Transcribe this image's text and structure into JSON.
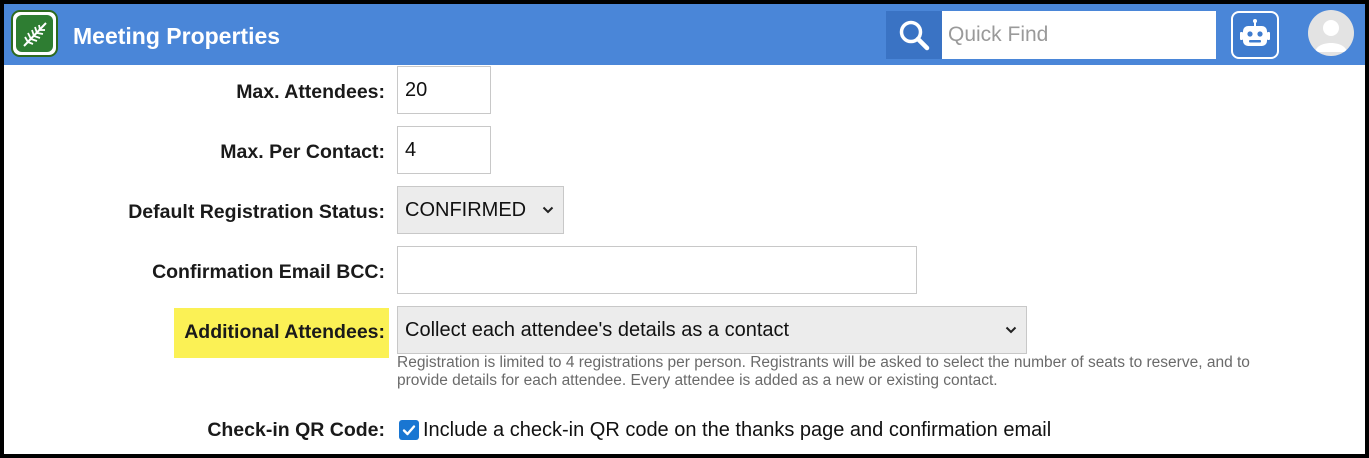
{
  "header": {
    "title": "Meeting Properties",
    "search_placeholder": "Quick Find",
    "icons": [
      "leaf-logo-icon",
      "search-icon",
      "robot-icon",
      "user-avatar-icon"
    ],
    "colors": {
      "bar": "#4a86d8",
      "search_button": "#3a73c4"
    }
  },
  "form": {
    "max_attendees": {
      "label": "Max. Attendees:",
      "value": "20"
    },
    "max_per_contact": {
      "label": "Max. Per Contact:",
      "value": "4"
    },
    "default_status": {
      "label": "Default Registration Status:",
      "value": "CONFIRMED"
    },
    "confirmation_bcc": {
      "label": "Confirmation Email BCC:",
      "value": ""
    },
    "additional_attendees": {
      "label": "Additional Attendees:",
      "value": "Collect each attendee's details as a contact",
      "help_line1": "Registration is limited to 4 registrations per person. Registrants will be asked to select the number of seats to reserve, and to",
      "help_line2": "provide details for each attendee. Every attendee is added as a new or existing contact.",
      "highlight_color": "#fbf155"
    },
    "qr_code": {
      "label": "Check-in QR Code:",
      "checked": true,
      "checkbox_label": "Include a check-in QR code on the thanks page and confirmation email"
    }
  }
}
